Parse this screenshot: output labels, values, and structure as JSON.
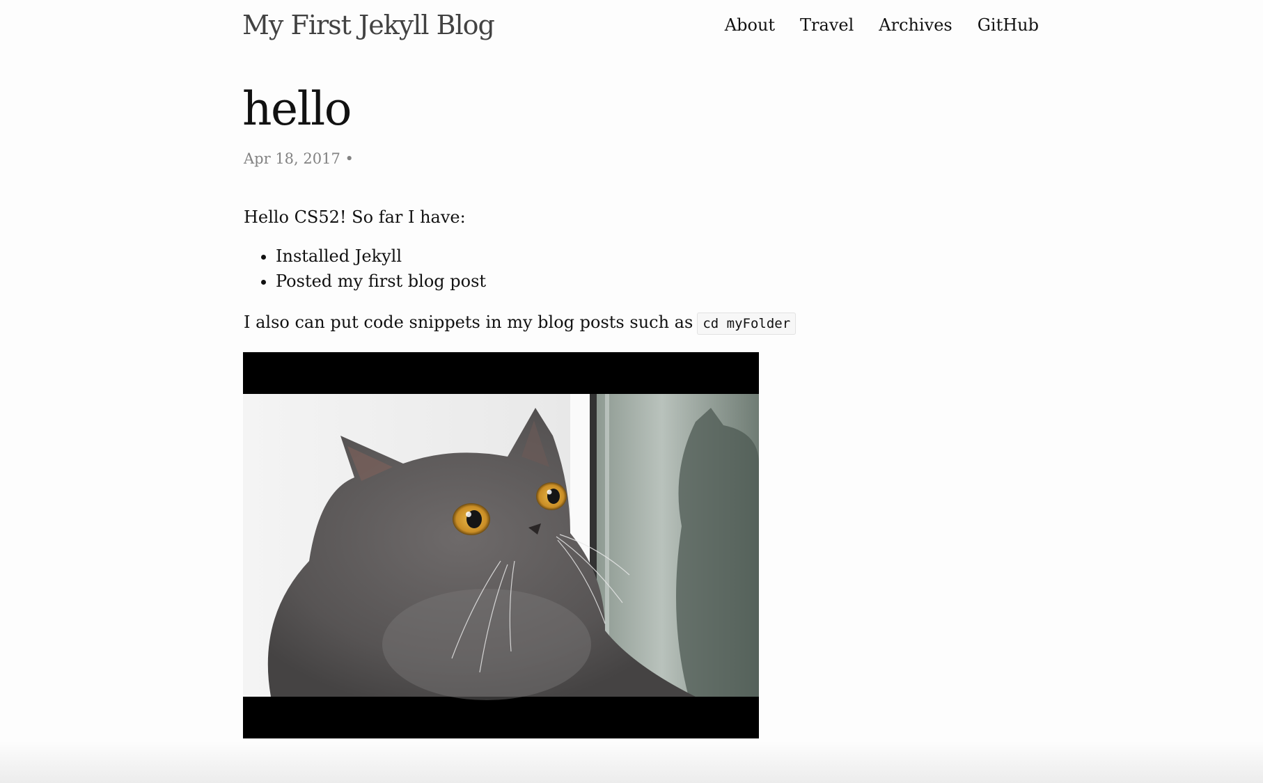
{
  "header": {
    "site_title": "My First Jekyll Blog",
    "nav": [
      "About",
      "Travel",
      "Archives",
      "GitHub"
    ]
  },
  "post": {
    "title": "hello",
    "meta": "Apr 18, 2017 •",
    "intro": "Hello CS52! So far I have:",
    "list": [
      "Installed Jekyll",
      "Posted my first blog post"
    ],
    "code_sentence": "I also can put code snippets in my blog posts such as",
    "code_snippet": "cd myFolder"
  },
  "image": {
    "subject": "gray cat looking up with wide orange eyes"
  },
  "colors": {
    "background": "#fdfdfd",
    "text": "#111111",
    "site_title": "#424242",
    "meta": "#828282"
  }
}
